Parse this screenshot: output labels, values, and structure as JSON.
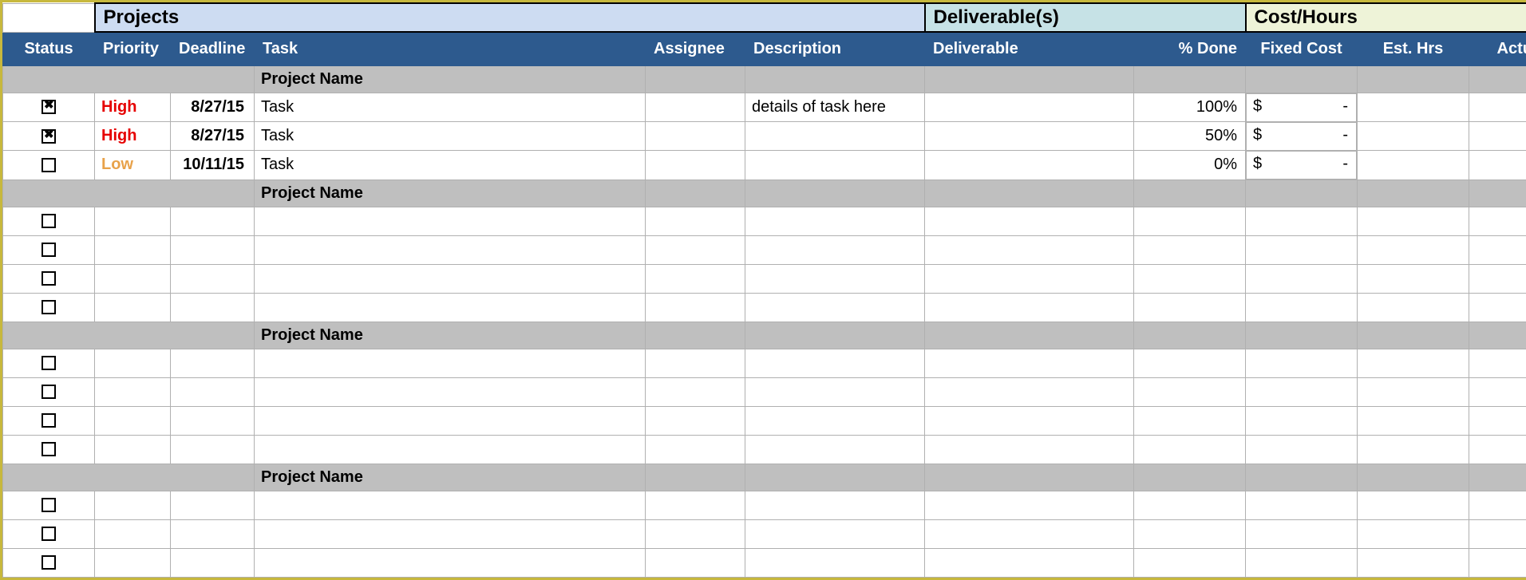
{
  "sections": {
    "projects": "Projects",
    "deliverables": "Deliverable(s)",
    "cost": "Cost/Hours"
  },
  "columns": {
    "status": "Status",
    "priority": "Priority",
    "deadline": "Deadline",
    "task": "Task",
    "assignee": "Assignee",
    "description": "Description",
    "deliverable": "Deliverable",
    "pct_done": "% Done",
    "fixed_cost": "Fixed Cost",
    "est_hrs": "Est. Hrs",
    "actual_hrs": "Actual Hrs"
  },
  "group_label": "Project Name",
  "currency_symbol": "$",
  "currency_empty": "-",
  "groups": [
    {
      "name": "Project Name",
      "rows": [
        {
          "checked": true,
          "priority": "High",
          "priority_class": "high",
          "deadline": "8/27/15",
          "task": "Task",
          "assignee": "",
          "description": "details of task here",
          "deliverable": "",
          "pct_done": "100%",
          "fixed_cost": "-",
          "est_hrs": "",
          "actual_hrs": ""
        },
        {
          "checked": true,
          "priority": "High",
          "priority_class": "high",
          "deadline": "8/27/15",
          "task": "Task",
          "assignee": "",
          "description": "",
          "deliverable": "",
          "pct_done": "50%",
          "fixed_cost": "-",
          "est_hrs": "",
          "actual_hrs": ""
        },
        {
          "checked": false,
          "priority": "Low",
          "priority_class": "low",
          "deadline": "10/11/15",
          "task": "Task",
          "assignee": "",
          "description": "",
          "deliverable": "",
          "pct_done": "0%",
          "fixed_cost": "-",
          "est_hrs": "",
          "actual_hrs": ""
        }
      ]
    },
    {
      "name": "Project Name",
      "rows": [
        {
          "checked": false,
          "priority": "",
          "priority_class": "",
          "deadline": "",
          "task": "",
          "assignee": "",
          "description": "",
          "deliverable": "",
          "pct_done": "",
          "fixed_cost": "",
          "est_hrs": "",
          "actual_hrs": ""
        },
        {
          "checked": false,
          "priority": "",
          "priority_class": "",
          "deadline": "",
          "task": "",
          "assignee": "",
          "description": "",
          "deliverable": "",
          "pct_done": "",
          "fixed_cost": "",
          "est_hrs": "",
          "actual_hrs": ""
        },
        {
          "checked": false,
          "priority": "",
          "priority_class": "",
          "deadline": "",
          "task": "",
          "assignee": "",
          "description": "",
          "deliverable": "",
          "pct_done": "",
          "fixed_cost": "",
          "est_hrs": "",
          "actual_hrs": ""
        },
        {
          "checked": false,
          "priority": "",
          "priority_class": "",
          "deadline": "",
          "task": "",
          "assignee": "",
          "description": "",
          "deliverable": "",
          "pct_done": "",
          "fixed_cost": "",
          "est_hrs": "",
          "actual_hrs": ""
        }
      ]
    },
    {
      "name": "Project Name",
      "rows": [
        {
          "checked": false,
          "priority": "",
          "priority_class": "",
          "deadline": "",
          "task": "",
          "assignee": "",
          "description": "",
          "deliverable": "",
          "pct_done": "",
          "fixed_cost": "",
          "est_hrs": "",
          "actual_hrs": ""
        },
        {
          "checked": false,
          "priority": "",
          "priority_class": "",
          "deadline": "",
          "task": "",
          "assignee": "",
          "description": "",
          "deliverable": "",
          "pct_done": "",
          "fixed_cost": "",
          "est_hrs": "",
          "actual_hrs": ""
        },
        {
          "checked": false,
          "priority": "",
          "priority_class": "",
          "deadline": "",
          "task": "",
          "assignee": "",
          "description": "",
          "deliverable": "",
          "pct_done": "",
          "fixed_cost": "",
          "est_hrs": "",
          "actual_hrs": ""
        },
        {
          "checked": false,
          "priority": "",
          "priority_class": "",
          "deadline": "",
          "task": "",
          "assignee": "",
          "description": "",
          "deliverable": "",
          "pct_done": "",
          "fixed_cost": "",
          "est_hrs": "",
          "actual_hrs": ""
        }
      ]
    },
    {
      "name": "Project Name",
      "rows": [
        {
          "checked": false,
          "priority": "",
          "priority_class": "",
          "deadline": "",
          "task": "",
          "assignee": "",
          "description": "",
          "deliverable": "",
          "pct_done": "",
          "fixed_cost": "",
          "est_hrs": "",
          "actual_hrs": ""
        },
        {
          "checked": false,
          "priority": "",
          "priority_class": "",
          "deadline": "",
          "task": "",
          "assignee": "",
          "description": "",
          "deliverable": "",
          "pct_done": "",
          "fixed_cost": "",
          "est_hrs": "",
          "actual_hrs": ""
        },
        {
          "checked": false,
          "priority": "",
          "priority_class": "",
          "deadline": "",
          "task": "",
          "assignee": "",
          "description": "",
          "deliverable": "",
          "pct_done": "",
          "fixed_cost": "",
          "est_hrs": "",
          "actual_hrs": ""
        }
      ]
    }
  ]
}
